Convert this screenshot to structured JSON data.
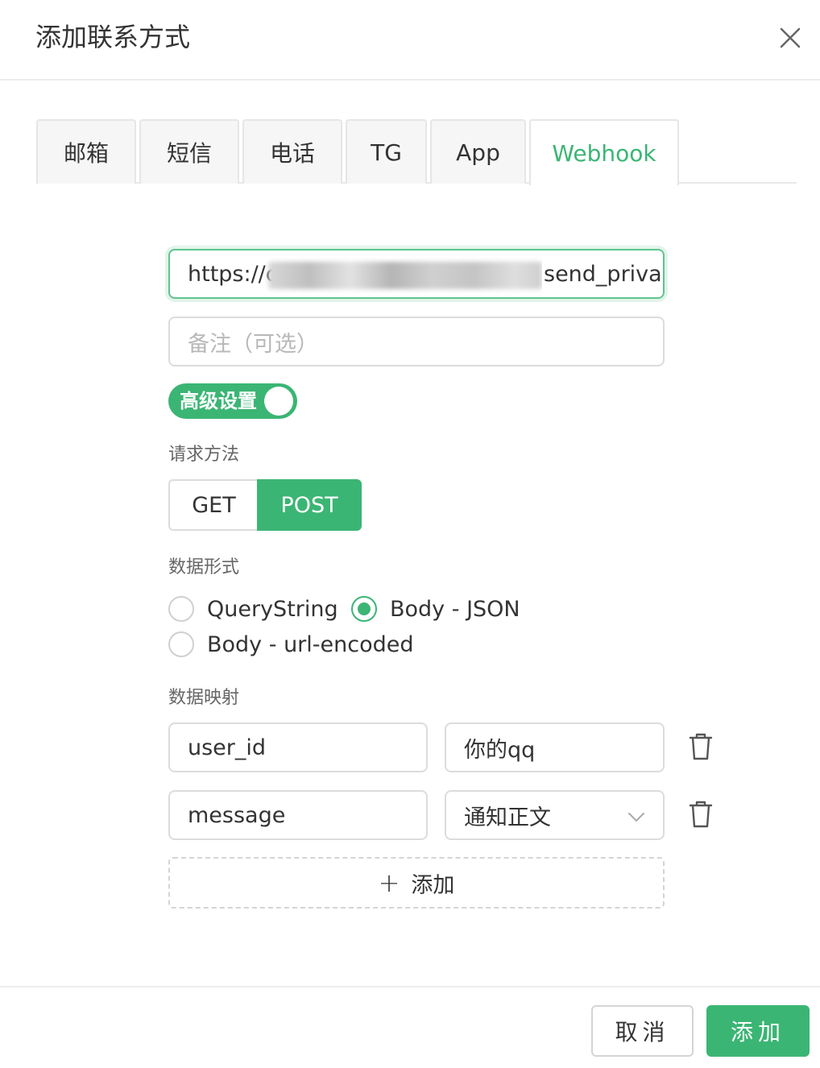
{
  "dialog": {
    "title": "添加联系方式"
  },
  "tabs": [
    {
      "label": "邮箱"
    },
    {
      "label": "短信"
    },
    {
      "label": "电话"
    },
    {
      "label": "TG"
    },
    {
      "label": "App"
    },
    {
      "label": "Webhook",
      "active": true
    }
  ],
  "form": {
    "url": {
      "prefix": "https://c",
      "suffix": "send_priva"
    },
    "note": {
      "placeholder": "备注（可选）"
    },
    "advanced_toggle": {
      "label": "高级设置",
      "on": true
    },
    "method": {
      "label": "请求方法",
      "options": [
        "GET",
        "POST"
      ],
      "selected": "POST"
    },
    "data_format": {
      "label": "数据形式",
      "options": [
        "QueryString",
        "Body - JSON",
        "Body - url-encoded"
      ],
      "selected": "Body - JSON"
    },
    "mapping": {
      "label": "数据映射",
      "rows": [
        {
          "key": "user_id",
          "value": "你的qq"
        },
        {
          "key": "message",
          "value": "通知正文"
        }
      ],
      "add_label": "添加"
    }
  },
  "footer": {
    "cancel_label": "取消",
    "confirm_label": "添加"
  },
  "colors": {
    "accent": "#3bb574",
    "border": "#dcdcdc",
    "text": "#333333"
  }
}
